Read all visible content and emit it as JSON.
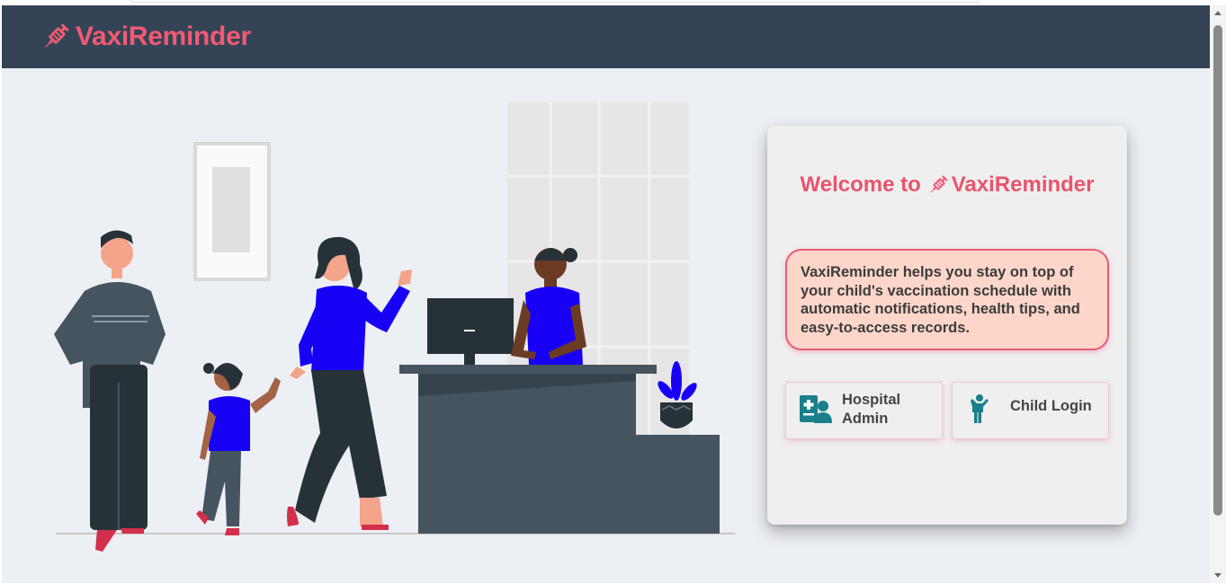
{
  "navbar": {
    "brand_name": "VaxiReminder",
    "brand_icon": "syringe-icon"
  },
  "card": {
    "welcome_prefix": "Welcome to",
    "welcome_brand": "VaxiReminder",
    "description": "VaxiReminder helps you stay on top of your child's vaccination schedule with automatic notifications, health tips, and easy-to-access records.",
    "hospital_admin_label": "Hospital Admin",
    "child_login_label": "Child Login",
    "hospital_admin_icon": "hospital-staff-icon",
    "child_login_icon": "child-figure-icon"
  },
  "colors": {
    "navbar_bg": "#344456",
    "brand": "#f25a73",
    "info_box_bg": "#fdd6c9",
    "info_box_border": "#e65c7b",
    "icon_teal": "#1a7f8c",
    "illustration_blue": "#1800f5"
  }
}
